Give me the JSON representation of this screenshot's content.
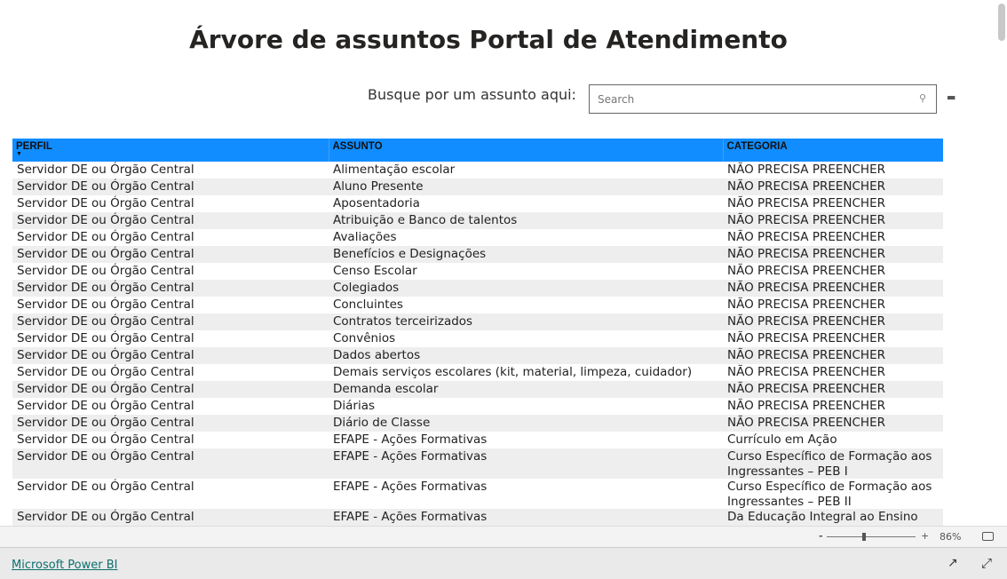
{
  "title": "Árvore de assuntos Portal de Atendimento",
  "search": {
    "label": "Busque por um assunto aqui:",
    "placeholder": "Search",
    "value": ""
  },
  "table": {
    "headers": [
      "PERFIL",
      "ASSUNTO",
      "CATEGORIA"
    ],
    "rows": [
      [
        "Servidor DE ou Órgão Central",
        "Alimentação escolar",
        "NÃO PRECISA PREENCHER"
      ],
      [
        "Servidor DE ou Órgão Central",
        "Aluno Presente",
        "NÃO PRECISA PREENCHER"
      ],
      [
        "Servidor DE ou Órgão Central",
        "Aposentadoria",
        "NÃO PRECISA PREENCHER"
      ],
      [
        "Servidor DE ou Órgão Central",
        "Atribuição e Banco de talentos",
        "NÃO PRECISA PREENCHER"
      ],
      [
        "Servidor DE ou Órgão Central",
        "Avaliações",
        "NÃO PRECISA PREENCHER"
      ],
      [
        "Servidor DE ou Órgão Central",
        "Benefícios e Designações",
        "NÃO PRECISA PREENCHER"
      ],
      [
        "Servidor DE ou Órgão Central",
        "Censo Escolar",
        "NÃO PRECISA PREENCHER"
      ],
      [
        "Servidor DE ou Órgão Central",
        "Colegiados",
        "NÃO PRECISA PREENCHER"
      ],
      [
        "Servidor DE ou Órgão Central",
        "Concluintes",
        "NÃO PRECISA PREENCHER"
      ],
      [
        "Servidor DE ou Órgão Central",
        "Contratos terceirizados",
        "NÃO PRECISA PREENCHER"
      ],
      [
        "Servidor DE ou Órgão Central",
        "Convênios",
        "NÃO PRECISA PREENCHER"
      ],
      [
        "Servidor DE ou Órgão Central",
        "Dados abertos",
        "NÃO PRECISA PREENCHER"
      ],
      [
        "Servidor DE ou Órgão Central",
        "Demais serviços escolares (kit, material, limpeza, cuidador)",
        "NÃO PRECISA PREENCHER"
      ],
      [
        "Servidor DE ou Órgão Central",
        "Demanda escolar",
        "NÃO PRECISA PREENCHER"
      ],
      [
        "Servidor DE ou Órgão Central",
        "Diárias",
        "NÃO PRECISA PREENCHER"
      ],
      [
        "Servidor DE ou Órgão Central",
        "Diário de Classe",
        "NÃO PRECISA PREENCHER"
      ],
      [
        "Servidor DE ou Órgão Central",
        "EFAPE - Ações Formativas",
        "Currículo em Ação"
      ],
      [
        "Servidor DE ou Órgão Central",
        "EFAPE - Ações Formativas",
        "Curso Específico de Formação aos Ingressantes – PEB I"
      ],
      [
        "Servidor DE ou Órgão Central",
        "EFAPE - Ações Formativas",
        "Curso Específico de Formação aos Ingressantes – PEB II"
      ],
      [
        "Servidor DE ou Órgão Central",
        "EFAPE - Ações Formativas",
        "Da Educação Integral ao Ensino"
      ]
    ]
  },
  "zoom": {
    "minus": "-",
    "plus": "+",
    "level": "86%",
    "value_percent": 86
  },
  "footer": {
    "link": "Microsoft Power BI"
  },
  "colors": {
    "header": "#118dff",
    "stripe": "#eeeeee"
  }
}
